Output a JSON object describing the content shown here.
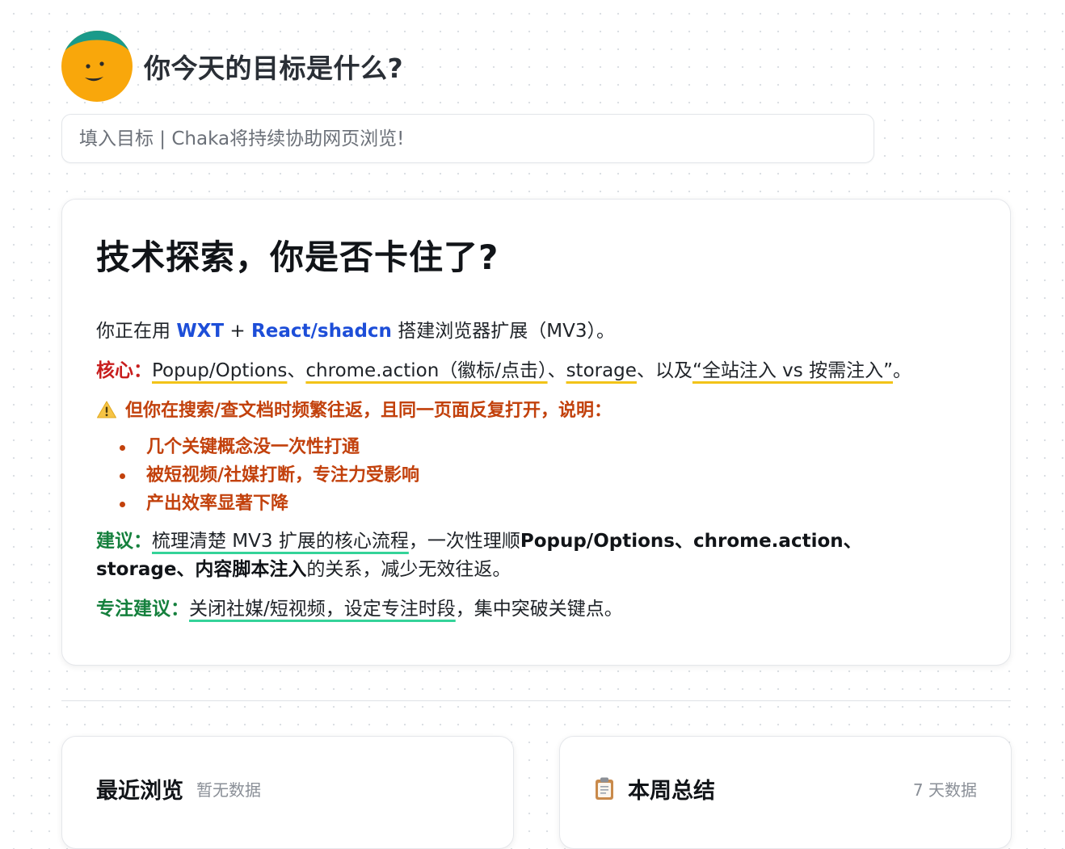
{
  "header": {
    "title": "你今天的目标是什么?"
  },
  "goal_input": {
    "placeholder": "填入目标 | Chaka将持续协助网页浏览!"
  },
  "insight": {
    "title": "技术探索，你是否卡住了?",
    "intro": {
      "prefix": "你正在用 ",
      "kw1": "WXT",
      "mid": " + ",
      "kw2": "React/shadcn",
      "suffix": " 搭建浏览器扩展（MV3）。"
    },
    "core": {
      "label": "核心：",
      "item1": "Popup/Options",
      "sep1": "、",
      "item2": "chrome.action（徽标/点击）",
      "sep2": "、",
      "item3": "storage",
      "sep3": "、以及",
      "item4": "“全站注入 vs 按需注入”",
      "end": "。"
    },
    "warning": {
      "text": "但你在搜索/查文档时频繁往返，且同一页面反复打开，说明：",
      "items": [
        "几个关键概念没一次性打通",
        "被短视频/社媒打断，专注力受影响",
        "产出效率显著下降"
      ]
    },
    "suggestion": {
      "label": "建议：",
      "underlined": "梳理清楚 MV3 扩展的核心流程",
      "plain1": "，一次性理顺",
      "bold1": "Popup/Options、chrome.action、storage、内容脚本注入",
      "plain2": "的关系，减少无效往返。"
    },
    "focus": {
      "label": "专注建议：",
      "underlined": "关闭社媒/短视频，设定专注时段",
      "plain": "，集中突破关键点。"
    }
  },
  "recent": {
    "title": "最近浏览",
    "meta": "暂无数据"
  },
  "weekly": {
    "title": "本周总结",
    "meta": "7 天数据"
  },
  "colors": {
    "accent_blue": "#1d4ed8",
    "core_red": "#c81e1e",
    "warning_orange": "#c2410c",
    "suggest_green": "#15803d",
    "underline_yellow": "#f2c318",
    "underline_green": "#34d399",
    "avatar_orange": "#f9a70b",
    "avatar_teal": "#1a9a8a"
  },
  "icons": {
    "avatar": "smiley-avatar-icon",
    "warning": "warning-triangle-icon",
    "weekly": "clipboard-icon"
  }
}
